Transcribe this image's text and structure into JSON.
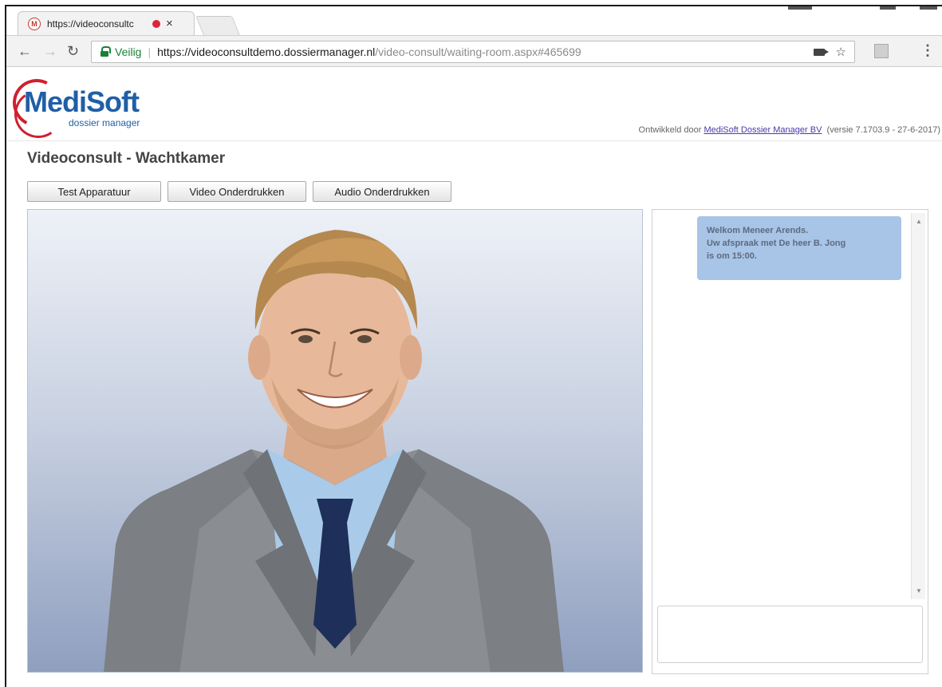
{
  "browser": {
    "tab_title": "https://videoconsultc",
    "tab_favicon_letter": "M",
    "secure_label": "Veilig",
    "url_host": "https://videoconsultdemo.dossiermanager.nl",
    "url_path": "/video-consult/waiting-room.aspx#465699"
  },
  "header": {
    "logo_text": "MediSoft",
    "logo_sub": "dossier manager",
    "credits_prefix": "Ontwikkeld door ",
    "credits_link": "MediSoft Dossier Manager BV",
    "credits_version": "(versie 7.1703.9 - 27-6-2017)"
  },
  "page": {
    "title": "Videoconsult - Wachtkamer",
    "buttons": {
      "test": "Test Apparatuur",
      "video": "Video Onderdrukken",
      "audio": "Audio Onderdrukken"
    }
  },
  "chat": {
    "messages": [
      {
        "line1": "Welkom Meneer Arends.",
        "line2": "Uw afspraak met De heer B. Jong",
        "line3": "is om 15:00."
      }
    ]
  },
  "colors": {
    "brand_blue": "#1f5fa6",
    "brand_red": "#d0202f",
    "bubble": "#a8c4e6",
    "secure_green": "#188038"
  }
}
